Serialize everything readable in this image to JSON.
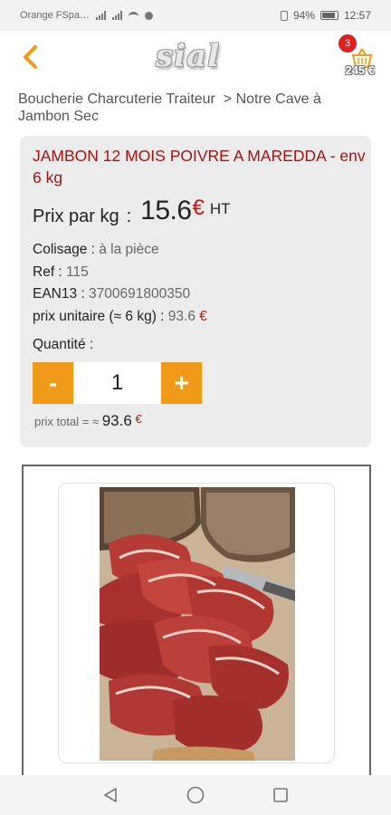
{
  "status_bar": {
    "carrier": "Orange FSpa…",
    "battery": "94%",
    "time": "12:57",
    "battery_level": 0.94
  },
  "header": {
    "logo": "sial",
    "cart_count": "3",
    "cart_total": "245 €"
  },
  "breadcrumb": {
    "items": [
      "Boucherie Charcuterie Traiteur",
      "Notre Cave à Jambon Sec"
    ],
    "separator": ">"
  },
  "product": {
    "title": "JAMBON 12 MOIS POIVRE A MAREDDA - env 6 kg",
    "price_label": "Prix par kg",
    "price_colon": ":",
    "price_value": "15.6",
    "price_currency": "€",
    "price_suffix": "HT",
    "details": [
      {
        "label": "Colisage :",
        "value": "à la pièce"
      },
      {
        "label": "Ref :",
        "value": "115"
      },
      {
        "label": "EAN13 :",
        "value": "3700691800350"
      }
    ],
    "unit_price_label": "prix unitaire (≈ 6 kg) :",
    "unit_price_value": "93.6",
    "unit_price_currency": "€",
    "quantity_label": "Quantité :",
    "quantity_value": "1",
    "minus_label": "-",
    "plus_label": "+",
    "total_label": "prix total = ≈",
    "total_value": "93.6",
    "total_currency": "€"
  },
  "colors": {
    "accent": "#f09a1a",
    "title_red": "#a31212",
    "euro_red": "#c41818",
    "card_bg": "#ececec",
    "badge_red": "#e02020"
  },
  "icons": {
    "back": "chevron-left-icon",
    "cart": "basket-icon",
    "nav_back": "triangle-back-icon",
    "nav_home": "circle-home-icon",
    "nav_recent": "square-recent-icon"
  }
}
